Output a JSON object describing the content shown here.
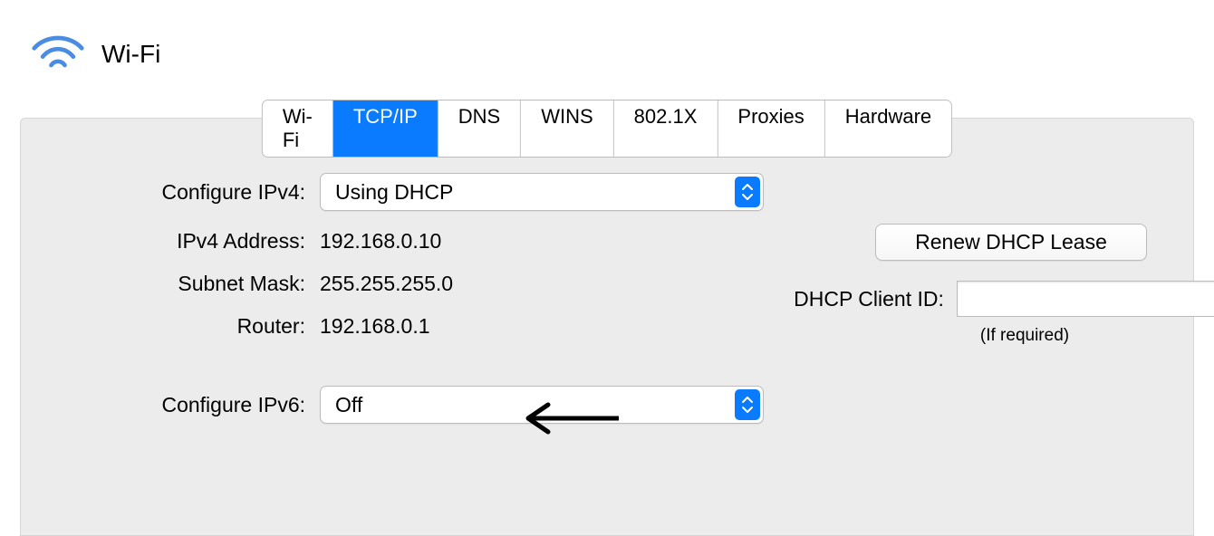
{
  "header": {
    "title": "Wi-Fi"
  },
  "tabs": [
    {
      "label": "Wi-Fi"
    },
    {
      "label": "TCP/IP"
    },
    {
      "label": "DNS"
    },
    {
      "label": "WINS"
    },
    {
      "label": "802.1X"
    },
    {
      "label": "Proxies"
    },
    {
      "label": "Hardware"
    }
  ],
  "ipv4": {
    "configure_label": "Configure IPv4:",
    "configure_value": "Using DHCP",
    "address_label": "IPv4 Address:",
    "address_value": "192.168.0.10",
    "subnet_label": "Subnet Mask:",
    "subnet_value": "255.255.255.0",
    "router_label": "Router:",
    "router_value": "192.168.0.1"
  },
  "ipv6": {
    "configure_label": "Configure IPv6:",
    "configure_value": "Off"
  },
  "dhcp": {
    "renew_label": "Renew DHCP Lease",
    "client_id_label": "DHCP Client ID:",
    "client_id_value": "",
    "client_id_hint": "(If required)"
  }
}
